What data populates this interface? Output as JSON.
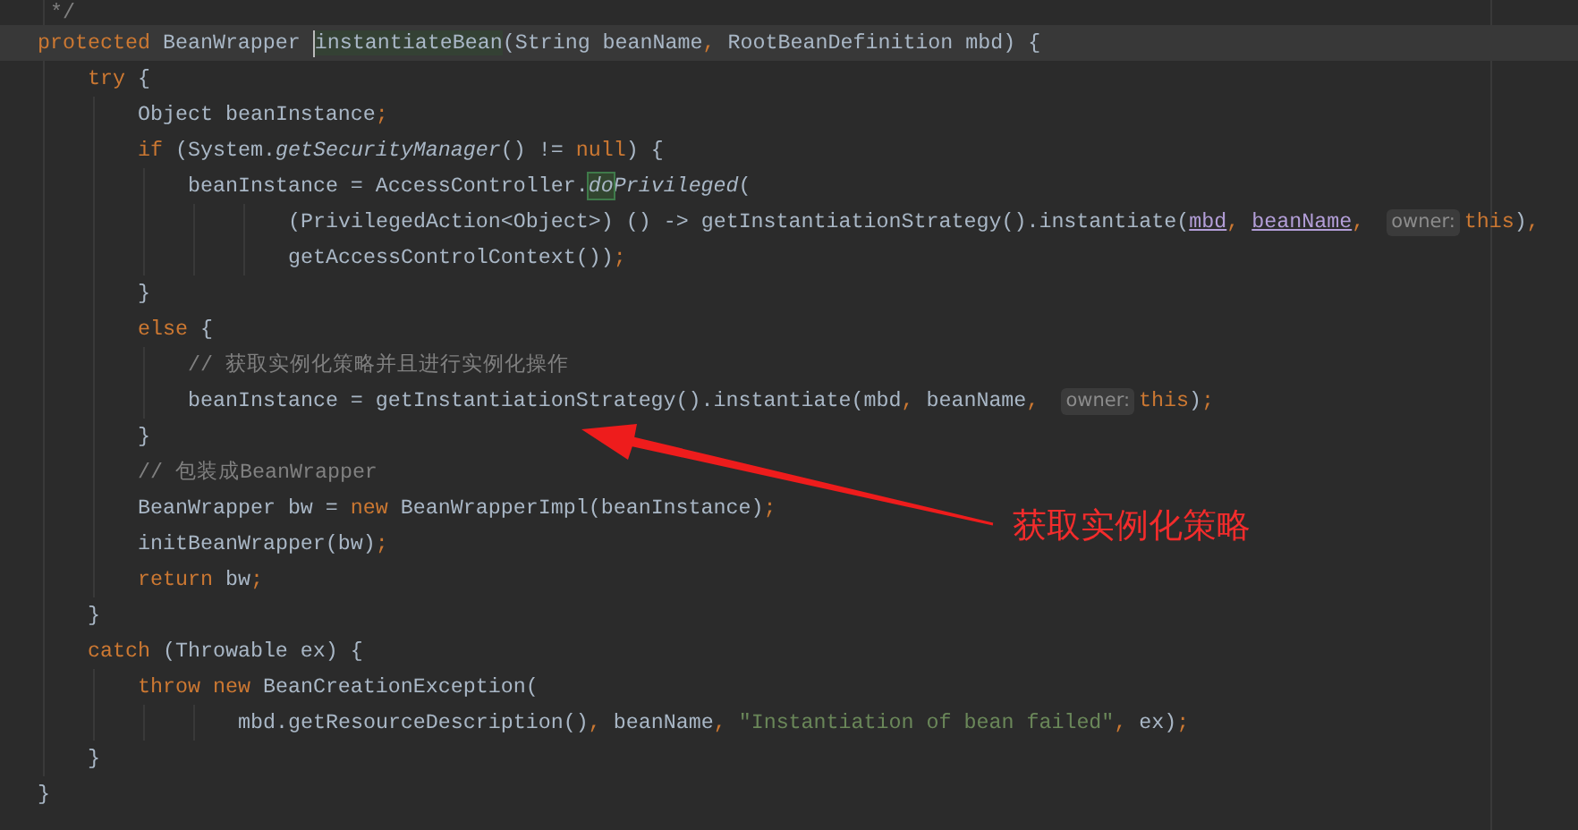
{
  "editor": {
    "fragment": {
      "tokens": [
        {
          "kind": "comment",
          "text": "*/"
        }
      ]
    },
    "lines": [
      {
        "current": true,
        "tokens": [
          {
            "kind": "kw",
            "text": "protected"
          },
          {
            "kind": "plain",
            "text": " BeanWrapper "
          },
          {
            "kind": "caret"
          },
          {
            "kind": "hl",
            "text": "instantiateBean"
          },
          {
            "kind": "plain",
            "text": "(String beanName"
          },
          {
            "kind": "punct",
            "text": ","
          },
          {
            "kind": "plain",
            "text": " RootBeanDefinition mbd) {"
          }
        ],
        "children": [
          {
            "current": false,
            "tokens": [
              {
                "kind": "kw",
                "text": "try"
              },
              {
                "kind": "plain",
                "text": " {"
              }
            ],
            "children": [
              {
                "current": false,
                "tokens": [
                  {
                    "kind": "plain",
                    "text": "Object beanInstance"
                  },
                  {
                    "kind": "punct",
                    "text": ";"
                  }
                ]
              },
              {
                "current": false,
                "tokens": [
                  {
                    "kind": "kw",
                    "text": "if"
                  },
                  {
                    "kind": "plain",
                    "text": " (System."
                  },
                  {
                    "kind": "italic",
                    "text": "getSecurityManager"
                  },
                  {
                    "kind": "plain",
                    "text": "() != "
                  },
                  {
                    "kind": "kw",
                    "text": "null"
                  },
                  {
                    "kind": "plain",
                    "text": ") {"
                  }
                ],
                "children": [
                  {
                    "current": false,
                    "tokens": [
                      {
                        "kind": "plain",
                        "text": "beanInstance = AccessController."
                      },
                      {
                        "kind": "box",
                        "text": "do"
                      },
                      {
                        "kind": "italic",
                        "text": "Privileged"
                      },
                      {
                        "kind": "plain",
                        "text": "("
                      }
                    ],
                    "continued": [
                      {
                        "current": false,
                        "tokens": [
                          {
                            "kind": "plain",
                            "text": "(PrivilegedAction<Object>) () -> getInstantiationStrategy().instantiate("
                          },
                          {
                            "kind": "param",
                            "text": "mbd"
                          },
                          {
                            "kind": "punct",
                            "text": ", "
                          },
                          {
                            "kind": "param",
                            "text": "beanName"
                          },
                          {
                            "kind": "punct",
                            "text": ","
                          },
                          {
                            "kind": "hint",
                            "text": "owner:"
                          },
                          {
                            "kind": "kw",
                            "text": "this"
                          },
                          {
                            "kind": "plain",
                            "text": ")"
                          },
                          {
                            "kind": "punct",
                            "text": ","
                          }
                        ]
                      },
                      {
                        "current": false,
                        "tokens": [
                          {
                            "kind": "plain",
                            "text": "getAccessControlContext())"
                          },
                          {
                            "kind": "punct",
                            "text": ";"
                          }
                        ]
                      }
                    ]
                  }
                ]
              },
              {
                "current": false,
                "tokens": [
                  {
                    "kind": "plain",
                    "text": "}"
                  }
                ]
              },
              {
                "current": false,
                "tokens": [
                  {
                    "kind": "kw",
                    "text": "else"
                  },
                  {
                    "kind": "plain",
                    "text": " {"
                  }
                ],
                "children": [
                  {
                    "current": false,
                    "tokens": [
                      {
                        "kind": "comment",
                        "text": "// 获取实例化策略并且进行实例化操作"
                      }
                    ]
                  },
                  {
                    "current": false,
                    "tokens": [
                      {
                        "kind": "plain",
                        "text": "beanInstance = getInstantiationStrategy().instantiate(mbd"
                      },
                      {
                        "kind": "punct",
                        "text": ","
                      },
                      {
                        "kind": "plain",
                        "text": " beanName"
                      },
                      {
                        "kind": "punct",
                        "text": ","
                      },
                      {
                        "kind": "hint",
                        "text": "owner:"
                      },
                      {
                        "kind": "kw",
                        "text": "this"
                      },
                      {
                        "kind": "plain",
                        "text": ")"
                      },
                      {
                        "kind": "punct",
                        "text": ";"
                      }
                    ]
                  }
                ]
              },
              {
                "current": false,
                "tokens": [
                  {
                    "kind": "plain",
                    "text": "}"
                  }
                ]
              },
              {
                "current": false,
                "tokens": [
                  {
                    "kind": "comment",
                    "text": "// 包装成BeanWrapper"
                  }
                ]
              },
              {
                "current": false,
                "tokens": [
                  {
                    "kind": "plain",
                    "text": "BeanWrapper bw = "
                  },
                  {
                    "kind": "kw",
                    "text": "new"
                  },
                  {
                    "kind": "plain",
                    "text": " BeanWrapperImpl(beanInstance)"
                  },
                  {
                    "kind": "punct",
                    "text": ";"
                  }
                ]
              },
              {
                "current": false,
                "tokens": [
                  {
                    "kind": "plain",
                    "text": "initBeanWrapper(bw)"
                  },
                  {
                    "kind": "punct",
                    "text": ";"
                  }
                ]
              },
              {
                "current": false,
                "tokens": [
                  {
                    "kind": "kw",
                    "text": "return"
                  },
                  {
                    "kind": "plain",
                    "text": " bw"
                  },
                  {
                    "kind": "punct",
                    "text": ";"
                  }
                ]
              }
            ]
          },
          {
            "current": false,
            "tokens": [
              {
                "kind": "plain",
                "text": "}"
              }
            ]
          },
          {
            "current": false,
            "tokens": [
              {
                "kind": "kw",
                "text": "catch"
              },
              {
                "kind": "plain",
                "text": " (Throwable ex) {"
              }
            ],
            "children": [
              {
                "current": false,
                "tokens": [
                  {
                    "kind": "kw",
                    "text": "throw new"
                  },
                  {
                    "kind": "plain",
                    "text": " BeanCreationException("
                  }
                ],
                "continued": [
                  {
                    "current": false,
                    "tokens": [
                      {
                        "kind": "plain",
                        "text": "mbd.getResourceDescription()"
                      },
                      {
                        "kind": "punct",
                        "text": ","
                      },
                      {
                        "kind": "plain",
                        "text": " beanName"
                      },
                      {
                        "kind": "punct",
                        "text": ", "
                      },
                      {
                        "kind": "string",
                        "text": "\"Instantiation of bean failed\""
                      },
                      {
                        "kind": "punct",
                        "text": ","
                      },
                      {
                        "kind": "plain",
                        "text": " ex)"
                      },
                      {
                        "kind": "punct",
                        "text": ";"
                      }
                    ]
                  }
                ]
              }
            ]
          },
          {
            "current": false,
            "tokens": [
              {
                "kind": "plain",
                "text": "}"
              }
            ]
          }
        ]
      },
      {
        "current": false,
        "tokens": [
          {
            "kind": "plain",
            "text": "}"
          }
        ]
      }
    ]
  },
  "annotation": {
    "label": "获取实例化策略"
  }
}
